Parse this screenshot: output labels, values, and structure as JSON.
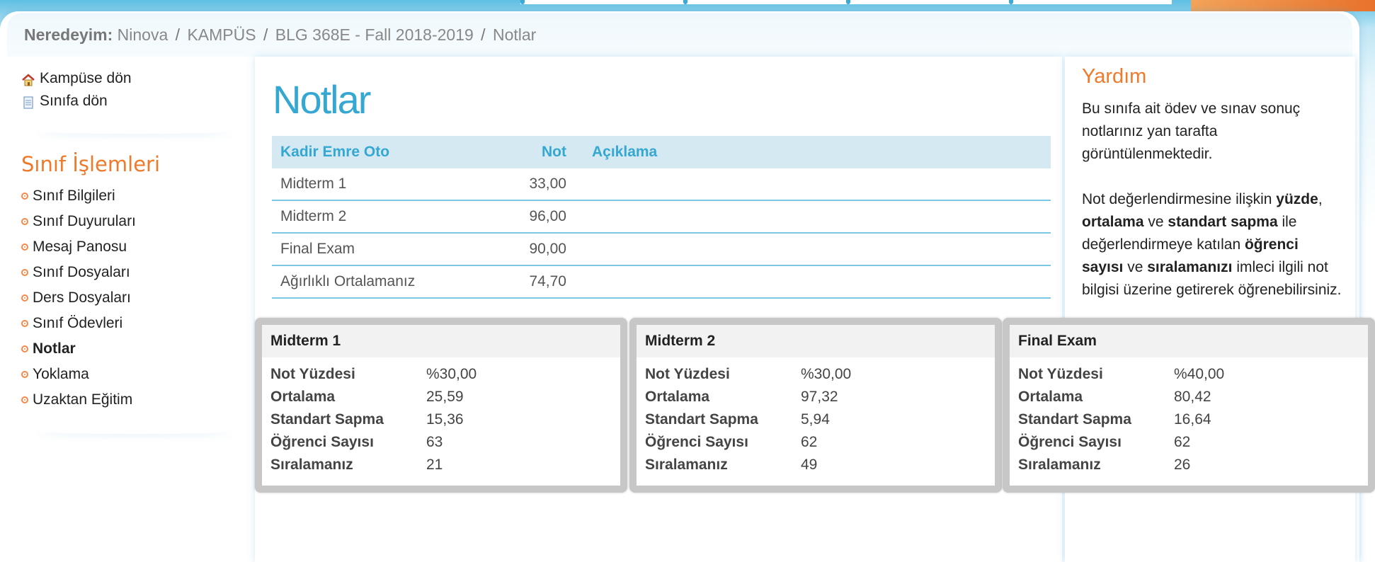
{
  "breadcrumb": {
    "lead": "Neredeyim:",
    "items": [
      "Ninova",
      "KAMPÜS",
      "BLG 368E - Fall 2018-2019",
      "Notlar"
    ]
  },
  "sidebar": {
    "quick_links": [
      {
        "label": "Kampüse dön",
        "icon": "home-icon"
      },
      {
        "label": "Sınıfa dön",
        "icon": "notepad-icon"
      }
    ],
    "section_title": "Sınıf İşlemleri",
    "menu": [
      {
        "label": "Sınıf Bilgileri"
      },
      {
        "label": "Sınıf Duyuruları"
      },
      {
        "label": "Mesaj Panosu"
      },
      {
        "label": "Sınıf Dosyaları"
      },
      {
        "label": "Ders Dosyaları"
      },
      {
        "label": "Sınıf Ödevleri"
      },
      {
        "label": "Notlar"
      },
      {
        "label": "Yoklama"
      },
      {
        "label": "Uzaktan Eğitim"
      }
    ],
    "active": "Notlar"
  },
  "main": {
    "title": "Notlar",
    "table": {
      "headers": [
        "Kadir Emre Oto",
        "Not",
        "Açıklama"
      ],
      "rows": [
        {
          "name": "Midterm 1",
          "grade": "33,00",
          "note": ""
        },
        {
          "name": "Midterm 2",
          "grade": "96,00",
          "note": ""
        },
        {
          "name": "Final Exam",
          "grade": "90,00",
          "note": ""
        },
        {
          "name": "Ağırlıklı Ortalamanız",
          "grade": "74,70",
          "note": ""
        }
      ]
    }
  },
  "help": {
    "title": "Yardım",
    "p1": "Bu sınıfa ait ödev ve sınav sonuç notlarınız yan tarafta görüntülenmektedir.",
    "p2_parts": [
      "Not değerlendirmesine ilişkin ",
      "yüzde",
      ", ",
      "ortalama",
      " ve ",
      "standart sapma",
      " ile değerlendirmeye katılan ",
      "öğrenci sayısı",
      " ve ",
      "sıralamanızı",
      " imleci ilgili not bilgisi üzerine getirerek öğrenebilirsiniz."
    ]
  },
  "popups": [
    {
      "title": "Midterm 1",
      "rows": [
        {
          "k": "Not Yüzdesi",
          "v": "%30,00"
        },
        {
          "k": "Ortalama",
          "v": "25,59"
        },
        {
          "k": "Standart Sapma",
          "v": "15,36"
        },
        {
          "k": "Öğrenci Sayısı",
          "v": "63"
        },
        {
          "k": "Sıralamanız",
          "v": "21"
        }
      ]
    },
    {
      "title": "Midterm 2",
      "rows": [
        {
          "k": "Not Yüzdesi",
          "v": "%30,00"
        },
        {
          "k": "Ortalama",
          "v": "97,32"
        },
        {
          "k": "Standart Sapma",
          "v": "5,94"
        },
        {
          "k": "Öğrenci Sayısı",
          "v": "62"
        },
        {
          "k": "Sıralamanız",
          "v": "49"
        }
      ]
    },
    {
      "title": "Final Exam",
      "rows": [
        {
          "k": "Not Yüzdesi",
          "v": "%40,00"
        },
        {
          "k": "Ortalama",
          "v": "80,42"
        },
        {
          "k": "Standart Sapma",
          "v": "16,64"
        },
        {
          "k": "Öğrenci Sayısı",
          "v": "62"
        },
        {
          "k": "Sıralamanız",
          "v": "26"
        }
      ]
    }
  ],
  "colors": {
    "accent_blue": "#35a7d3",
    "accent_orange": "#ef7a2c",
    "table_header_bg": "#d4e9f1"
  }
}
